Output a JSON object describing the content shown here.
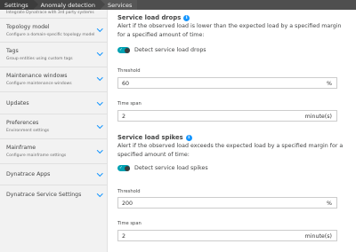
{
  "breadcrumb": [
    "Settings",
    "Anomaly detection",
    "Services"
  ],
  "sidebar": {
    "top_subtitle": "Integrate Dynatrace with 3rd party systems",
    "items": [
      {
        "title": "Topology model",
        "subtitle": "Configure a domain-specific topology model"
      },
      {
        "title": "Tags",
        "subtitle": "Group entities using custom tags"
      },
      {
        "title": "Maintenance windows",
        "subtitle": "Configure maintenance windows"
      },
      {
        "title": "Updates",
        "subtitle": ""
      },
      {
        "title": "Preferences",
        "subtitle": "Environment settings"
      },
      {
        "title": "Mainframe",
        "subtitle": "Configure mainframe settings"
      },
      {
        "title": "Dynatrace Apps",
        "subtitle": ""
      },
      {
        "title": "Dynatrace Service Settings",
        "subtitle": ""
      }
    ]
  },
  "drops": {
    "title": "Service load drops",
    "description": "Alert if the observed load is lower than the expected load by a specified margin for a specified amount of time:",
    "toggle_label": "Detect service load drops",
    "threshold_label": "Threshold",
    "threshold_value": "60",
    "threshold_unit": "%",
    "timespan_label": "Time span",
    "timespan_value": "2",
    "timespan_unit": "minute(s)"
  },
  "spikes": {
    "title": "Service load spikes",
    "description": "Alert if the observed load exceeds the expected load by a specified margin for a specified amount of time:",
    "toggle_label": "Detect service load spikes",
    "threshold_label": "Threshold",
    "threshold_value": "200",
    "threshold_unit": "%",
    "timespan_label": "Time span",
    "timespan_value": "2",
    "timespan_unit": "minute(s)"
  },
  "colors": {
    "accent": "#1496ff",
    "toggle_on": "#00a1b2"
  }
}
